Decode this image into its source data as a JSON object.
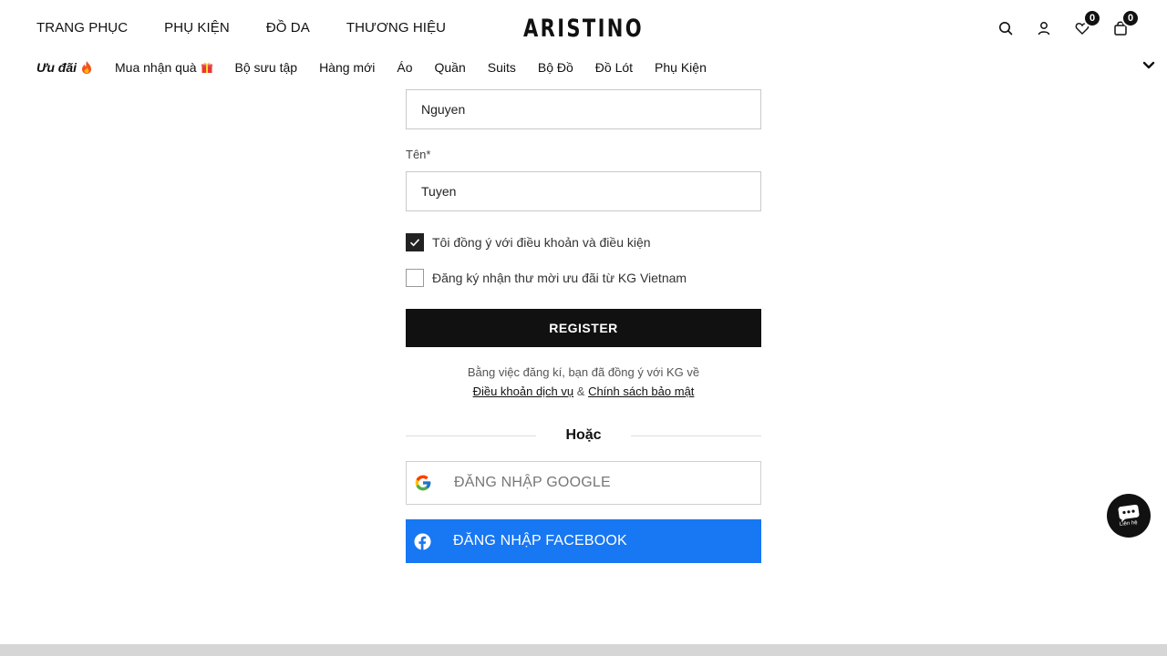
{
  "header": {
    "logo": "ARISTINO",
    "main_nav": [
      "TRANG PHỤC",
      "PHỤ KIỆN",
      "ĐỒ DA",
      "THƯƠNG HIỆU"
    ],
    "wishlist_count": "0",
    "cart_count": "0",
    "sub_nav": {
      "promo": "Ưu đãi",
      "items": [
        "Mua nhận quà",
        "Bộ sưu tập",
        "Hàng mới",
        "Áo",
        "Quần",
        "Suits",
        "Bộ Đồ",
        "Đồ Lót",
        "Phụ Kiện"
      ]
    }
  },
  "form": {
    "last_name_value": "Nguyen",
    "first_name_label": "Tên*",
    "first_name_value": "Tuyen",
    "agree_terms": {
      "label": "Tôi đồng ý với điều khoản và điều kiện",
      "checked": true
    },
    "newsletter": {
      "label": "Đăng ký nhận thư mời ưu đãi từ KG Vietnam",
      "checked": false
    },
    "register_label": "REGISTER",
    "terms_text": "Bằng việc đăng kí, bạn đã đồng ý với KG về",
    "terms_link": "Điều khoản dịch vụ",
    "terms_amp": "&",
    "privacy_link": "Chính sách bảo mật",
    "or_label": "Hoặc",
    "google_label": "ĐĂNG NHẬP GOOGLE",
    "facebook_label": "ĐĂNG NHẬP FACEBOOK"
  },
  "chat": {
    "label": "Liên hệ"
  },
  "colors": {
    "primary": "#111111",
    "facebook": "#1877f2",
    "border": "#c9c9c9"
  }
}
